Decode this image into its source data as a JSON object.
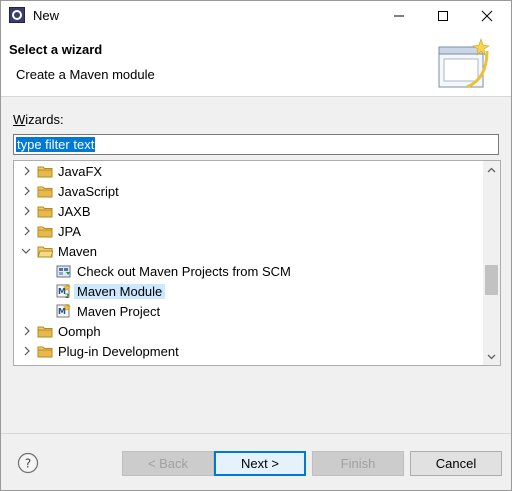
{
  "window": {
    "title": "New"
  },
  "header": {
    "title": "Select a wizard",
    "message": "Create a Maven module"
  },
  "wizards_label": "Wizards:",
  "filter": {
    "value": "type filter text"
  },
  "tree": {
    "items": [
      {
        "label": "JavaFX",
        "expanded": false,
        "icon": "folder-icon"
      },
      {
        "label": "JavaScript",
        "expanded": false,
        "icon": "folder-icon"
      },
      {
        "label": "JAXB",
        "expanded": false,
        "icon": "folder-icon"
      },
      {
        "label": "JPA",
        "expanded": false,
        "icon": "folder-icon"
      },
      {
        "label": "Maven",
        "expanded": true,
        "icon": "folder-icon"
      },
      {
        "label": "Check out Maven Projects from SCM",
        "icon": "checkout-icon"
      },
      {
        "label": "Maven Module",
        "icon": "maven-module-icon",
        "selected": true
      },
      {
        "label": "Maven Project",
        "icon": "maven-project-icon"
      },
      {
        "label": "Oomph",
        "expanded": false,
        "icon": "folder-icon"
      },
      {
        "label": "Plug-in Development",
        "expanded": false,
        "icon": "folder-icon"
      }
    ],
    "scroll_position": 0.62
  },
  "buttons": {
    "back": {
      "label": "< Back",
      "enabled": false
    },
    "next": {
      "label": "Next >",
      "enabled": true,
      "default": true
    },
    "finish": {
      "label": "Finish",
      "enabled": false
    },
    "cancel": {
      "label": "Cancel",
      "enabled": true
    }
  },
  "colors": {
    "selection": "#0078d7",
    "tree_selection": "#cce8ff",
    "folder": "#e8b84a"
  }
}
